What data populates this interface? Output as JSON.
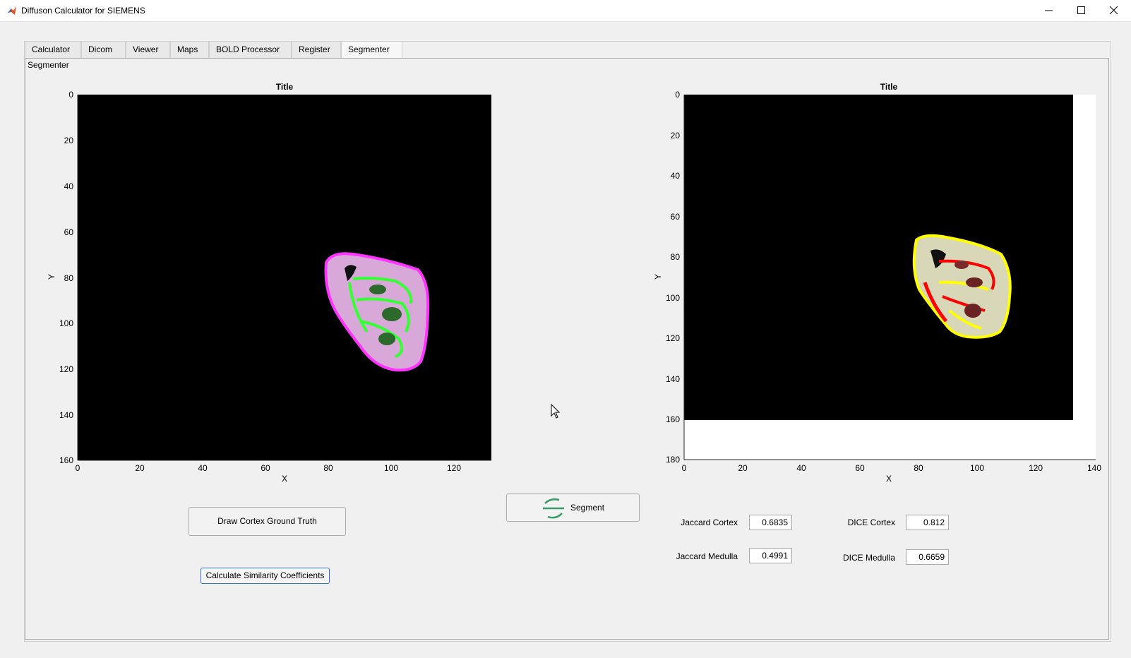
{
  "window": {
    "title": "Diffuson Calculator for SIEMENS",
    "icon": "matlab-icon"
  },
  "tabs": [
    {
      "label": "Calculator",
      "active": false
    },
    {
      "label": "Dicom",
      "active": false
    },
    {
      "label": "Viewer",
      "active": false
    },
    {
      "label": "Maps",
      "active": false
    },
    {
      "label": "BOLD Processor",
      "active": false
    },
    {
      "label": "Register",
      "active": false
    },
    {
      "label": "Segmenter",
      "active": true
    }
  ],
  "panel": {
    "title": "Segmenter"
  },
  "left_plot": {
    "title": "Title",
    "xlabel": "X",
    "ylabel": "Y",
    "xticks": [
      "0",
      "20",
      "40",
      "60",
      "80",
      "100",
      "120"
    ],
    "yticks": [
      "0",
      "20",
      "40",
      "60",
      "80",
      "100",
      "120",
      "140",
      "160"
    ],
    "overlay_colors": {
      "outer": "#ff33ff",
      "inner": "#33ff33"
    }
  },
  "right_plot": {
    "title": "Title",
    "xlabel": "X",
    "ylabel": "Y",
    "xticks": [
      "0",
      "20",
      "40",
      "60",
      "80",
      "100",
      "120",
      "140"
    ],
    "yticks": [
      "0",
      "20",
      "40",
      "60",
      "80",
      "100",
      "120",
      "140",
      "160",
      "180"
    ],
    "overlay_colors": {
      "outer": "#ffff00",
      "inner": "#ff0000"
    }
  },
  "buttons": {
    "draw_cortex": "Draw Cortex Ground Truth",
    "segment": "Segment",
    "calculate": "Calculate Similarity Coefficients"
  },
  "metrics": {
    "jaccard_cortex_label": "Jaccard Cortex",
    "jaccard_cortex_value": "0.6835",
    "jaccard_medulla_label": "Jaccard Medulla",
    "jaccard_medulla_value": "0.4991",
    "dice_cortex_label": "DICE Cortex",
    "dice_cortex_value": "0.812",
    "dice_medulla_label": "DICE Medulla",
    "dice_medulla_value": "0.6659"
  }
}
